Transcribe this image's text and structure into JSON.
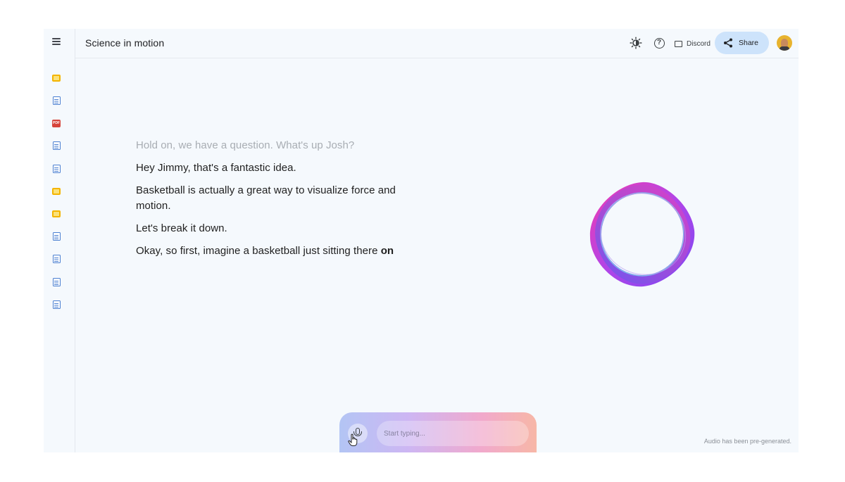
{
  "notebook": {
    "title": "Science in motion"
  },
  "sources": [
    {
      "type": "slides",
      "icon": "slides-icon"
    },
    {
      "type": "doc",
      "icon": "document-icon"
    },
    {
      "type": "pdf",
      "icon": "pdf-icon",
      "label": "PDF"
    },
    {
      "type": "doc",
      "icon": "document-icon"
    },
    {
      "type": "doc",
      "icon": "document-icon"
    },
    {
      "type": "slides",
      "icon": "slides-icon"
    },
    {
      "type": "slides",
      "icon": "slides-icon"
    },
    {
      "type": "doc",
      "icon": "document-icon"
    },
    {
      "type": "doc",
      "icon": "document-icon"
    },
    {
      "type": "doc",
      "icon": "document-icon"
    },
    {
      "type": "doc",
      "icon": "document-icon"
    }
  ],
  "toolbar": {
    "theme_icon": "brightness-icon",
    "help_icon": "help-icon",
    "discord_label": "Discord",
    "share_label": "Share"
  },
  "transcript": {
    "line_1": "Hold on, we have a question. What's up Josh?",
    "line_2": "Hey Jimmy, that's a fantastic idea.",
    "line_3": "Basketball is actually a great way to visualize force and motion.",
    "line_4": "Let's break it down.",
    "line_5_prefix": "Okay, so first, imagine a basketball just sitting there ",
    "line_5_bold": "on"
  },
  "input": {
    "placeholder": "Start typing..."
  },
  "footer": {
    "note": "Audio has been pre-generated."
  },
  "colors": {
    "accent_blue": "#cde3fb",
    "orb_pink": "#ee3fb4",
    "orb_purple": "#8a43f0",
    "orb_blue": "#4fb8f0"
  }
}
